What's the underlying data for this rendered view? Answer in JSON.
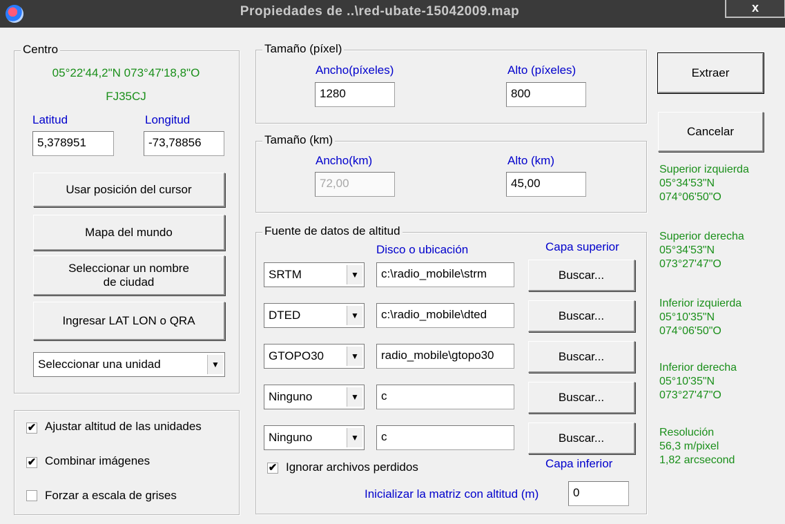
{
  "window": {
    "title": "Propiedades de ..\\red-ubate-15042009.map",
    "close_label": "x"
  },
  "centro": {
    "legend": "Centro",
    "coords": "05°22'44,2\"N 073°47'18,8\"O",
    "locator": "FJ35CJ",
    "lat_label": "Latitud",
    "lon_label": "Longitud",
    "lat_value": "5,378951",
    "lon_value": "-73,78856",
    "btn_cursor": "Usar posición del cursor",
    "btn_world": "Mapa del mundo",
    "btn_city": "Seleccionar un nombre de ciudad",
    "btn_latlon": "Ingresar LAT LON o QRA",
    "unit_select": "Seleccionar una unidad"
  },
  "options": {
    "adjust_altitude": {
      "label": "Ajustar altitud de las unidades",
      "checked": true
    },
    "combine_images": {
      "label": "Combinar imágenes",
      "checked": true
    },
    "grayscale": {
      "label": "Forzar a escala de grises",
      "checked": false
    }
  },
  "size_px": {
    "legend": "Tamaño (píxel)",
    "width_label": "Ancho(píxeles)",
    "height_label": "Alto (píxeles)",
    "width_value": "1280",
    "height_value": "800"
  },
  "size_km": {
    "legend": "Tamaño (km)",
    "width_label": "Ancho(km)",
    "height_label": "Alto (km)",
    "width_value": "72,00",
    "height_value": "45,00"
  },
  "elevation": {
    "legend": "Fuente de datos de altitud",
    "disk_header": "Disco o ubicación",
    "top_layer": "Capa superior",
    "bottom_layer": "Capa inferior",
    "rows": [
      {
        "source": "SRTM",
        "path": "c:\\radio_mobile\\strm",
        "button": "Buscar..."
      },
      {
        "source": "DTED",
        "path": "c:\\radio_mobile\\dted",
        "button": "Buscar..."
      },
      {
        "source": "GTOPO30",
        "path": "radio_mobile\\gtopo30",
        "button": "Buscar..."
      },
      {
        "source": "Ninguno",
        "path": "c",
        "button": "Buscar..."
      },
      {
        "source": "Ninguno",
        "path": "c",
        "button": "Buscar..."
      }
    ],
    "ignore_missing": {
      "label": "Ignorar archivos perdidos",
      "checked": true
    },
    "init_label": "Inicializar la matriz con altitud (m)",
    "init_value": "0"
  },
  "actions": {
    "extract": "Extraer",
    "cancel": "Cancelar"
  },
  "info": {
    "top_left": {
      "label": "Superior izquierda",
      "lat": "05°34'53\"N",
      "lon": "074°06'50\"O"
    },
    "top_right": {
      "label": "Superior derecha",
      "lat": "05°34'53\"N",
      "lon": "073°27'47\"O"
    },
    "bottom_left": {
      "label": "Inferior izquierda",
      "lat": "05°10'35\"N",
      "lon": "074°06'50\"O"
    },
    "bottom_right": {
      "label": "Inferior derecha",
      "lat": "05°10'35\"N",
      "lon": "073°27'47\"O"
    },
    "resolution": {
      "label": "Resolución",
      "meters": "56,3 m/pixel",
      "arcsec": "1,82 arcsecond"
    }
  },
  "colors": {
    "info_green": "#1a8f1a",
    "label_blue": "#0000cc",
    "titlebar": "#3a3a3a"
  },
  "icons": {
    "app": "radio-mobile-globe-icon",
    "dropdown": "chevron-down-icon",
    "check": "check-icon"
  }
}
